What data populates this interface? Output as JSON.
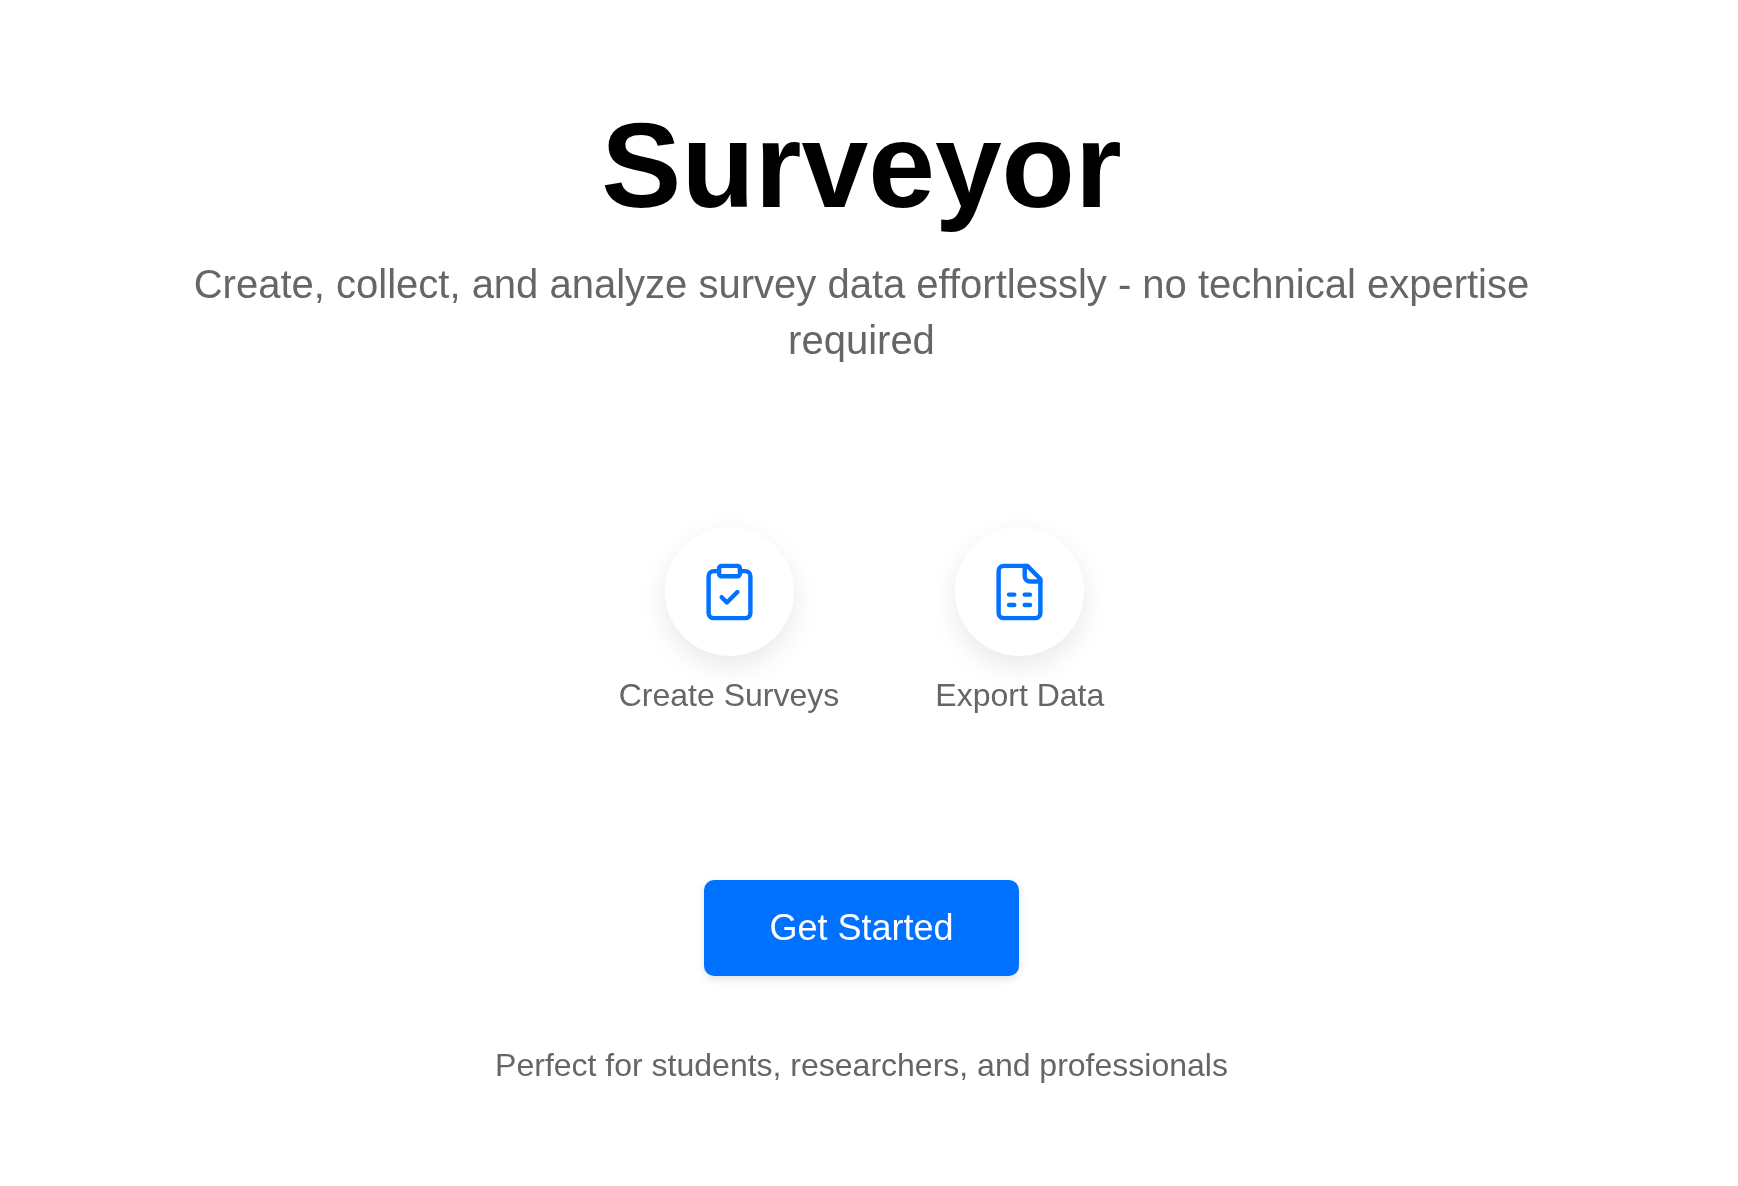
{
  "title": "Surveyor",
  "subtitle": "Create, collect, and analyze survey data effortlessly - no technical expertise required",
  "features": [
    {
      "kind": "clipboard-check",
      "label": "Create Surveys"
    },
    {
      "kind": "spreadsheet",
      "label": "Export Data"
    }
  ],
  "cta": {
    "label": "Get Started"
  },
  "footnote": "Perfect for students, researchers, and professionals"
}
